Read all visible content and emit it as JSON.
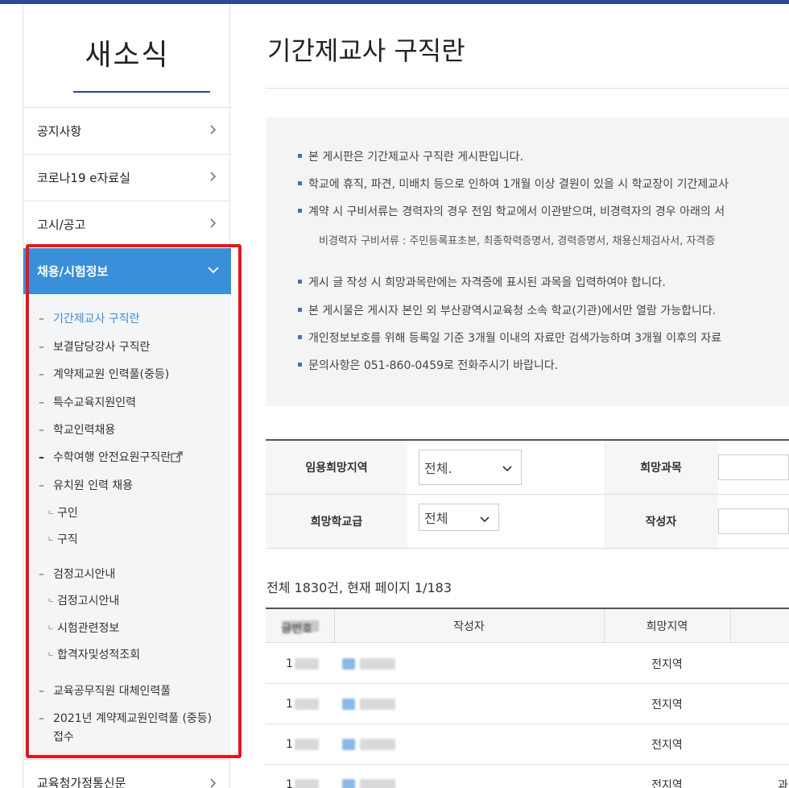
{
  "sidebar": {
    "title": "새소식",
    "menu": [
      {
        "label": "공지사항"
      },
      {
        "label": "코로나19 e자료실"
      },
      {
        "label": "고시/공고"
      }
    ],
    "active_menu": "채용/시험정보",
    "submenu": [
      {
        "label": "기간제교사 구직란"
      },
      {
        "label": "보결담당강사 구직란"
      },
      {
        "label": "계약제교원 인력풀(중등)"
      },
      {
        "label": "특수교육지원인력"
      },
      {
        "label": "학교인력채용"
      },
      {
        "label": "수학여행 안전요원구직란"
      },
      {
        "label": "유치원 인력 채용"
      },
      {
        "label": "구인"
      },
      {
        "label": "구직"
      },
      {
        "label": "검정고시안내"
      },
      {
        "label": "검정고시안내"
      },
      {
        "label": "시험관련정보"
      },
      {
        "label": "합격자및성적조회"
      },
      {
        "label": "교육공무직원 대체인력풀"
      },
      {
        "label": "2021년 계약제교원인력풀 (중등)"
      },
      {
        "label": "접수"
      }
    ],
    "bottom_menu": "교육청가정통신문"
  },
  "main": {
    "title": "기간제교사 구직란",
    "info": [
      "본 게시판은 기간제교사 구직란 게시판입니다.",
      "학교에 휴직, 파견, 미배치 등으로 인하여 1개월 이상 결원이 있을 시 학교장이 기간제교사",
      "계약 시 구비서류는 경력자의 경우 전임 학교에서 이관받으며, 비경력자의 경우 아래의 서",
      "비경력자 구비서류 : 주민등록표초본, 최종학력증명서, 경력증명서, 채용신체검사서, 자격증",
      "게시 글 작성 시 희망과목란에는 자격증에 표시된 과목을 입력하여야 합니다.",
      "본 게시물은 게시자 본인 외 부산광역시교육청 소속 학교(기관)에서만 열람 가능합니다.",
      "개인정보보호를 위해 등록일 기준 3개월 이내의 자료만 검색가능하며 3개월 이후의 자료",
      "문의사항은 051-860-0459로 전화주시기 바랍니다."
    ],
    "search": {
      "region_label": "임용희망지역",
      "region_value": "전체.",
      "subject_label": "희망과목",
      "school_label": "희망학교급",
      "school_value": "전체",
      "author_label": "작성자"
    },
    "total": "전체 1830건, 현재 페이지 1/183",
    "table": {
      "headers": [
        "글번호",
        "작성자",
        "희망지역"
      ],
      "rows": [
        {
          "region": "전지역"
        },
        {
          "region": "전지역"
        },
        {
          "region": "전지역"
        },
        {
          "region": "전지역",
          "extra": "과"
        }
      ]
    }
  }
}
